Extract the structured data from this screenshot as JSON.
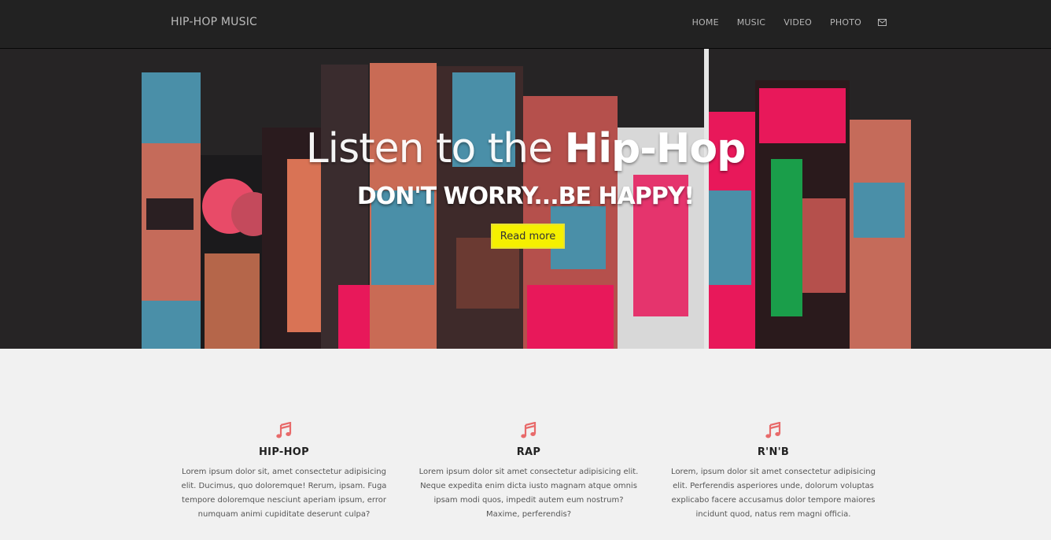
{
  "navbar": {
    "brand": "HIP-HOP MUSIC",
    "links": [
      {
        "label": "HOME"
      },
      {
        "label": "MUSIC"
      },
      {
        "label": "VIDEO"
      },
      {
        "label": "PHOTO"
      }
    ],
    "mail_icon": "envelope-icon"
  },
  "hero": {
    "title_light": "Listen to the ",
    "title_bold": "Hip-Hop",
    "subtitle": "DON'T WORRY...BE HAPPY!",
    "button_label": "Read more",
    "button_color": "#f5f000"
  },
  "features": [
    {
      "icon": "music-note-icon",
      "title": "HIP-HOP",
      "text": "Lorem ipsum dolor sit, amet consectetur adipisicing elit. Ducimus, quo doloremque! Rerum, ipsam. Fuga tempore doloremque nesciunt aperiam ipsum, error numquam animi cupiditate deserunt culpa?"
    },
    {
      "icon": "music-note-icon",
      "title": "RAP",
      "text": "Lorem ipsum dolor sit amet consectetur adipisicing elit. Neque expedita enim dicta iusto magnam atque omnis ipsam modi quos, impedit autem eum nostrum? Maxime, perferendis?"
    },
    {
      "icon": "music-note-icon",
      "title": "R'N'B",
      "text": "Lorem, ipsum dolor sit amet consectetur adipisicing elit. Perferendis asperiores unde, dolorum voluptas explicabo facere accusamus dolor tempore maiores incidunt quod, natus rem magni officia."
    }
  ],
  "colors": {
    "navbar_bg": "#222222",
    "hero_bg": "#262425",
    "accent_pink": "#e84b68",
    "page_bg": "#f1f1f1"
  }
}
